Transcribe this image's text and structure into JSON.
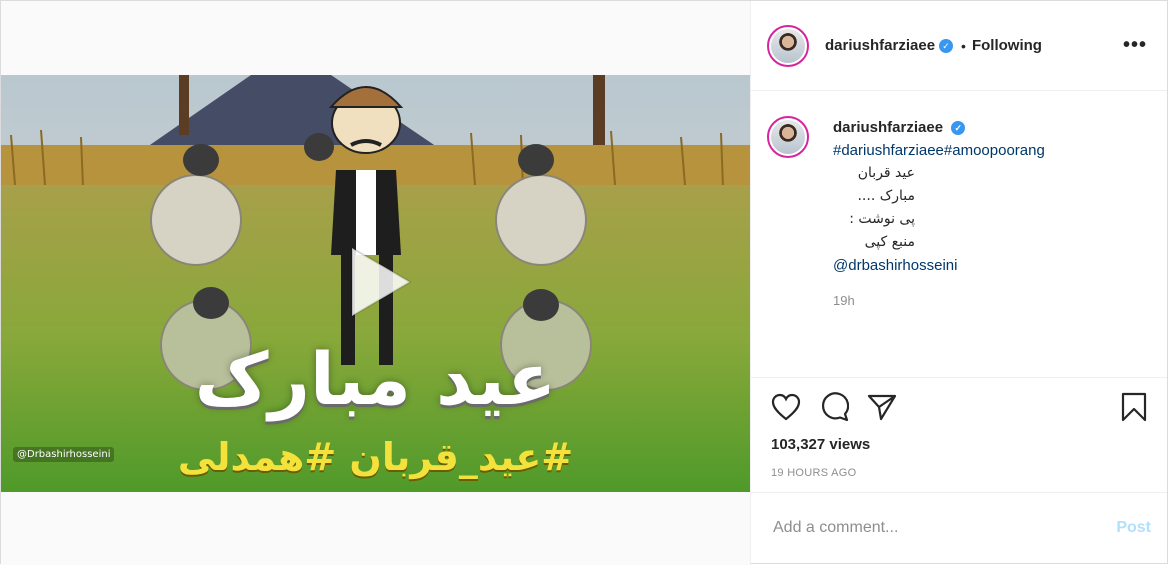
{
  "post": {
    "username": "dariushfarziaee",
    "following_label": "Following",
    "more_icon": "more-horizontal-icon"
  },
  "media": {
    "watermark": "@Drbashirhosseini",
    "overlay_title": "عید مبارک",
    "overlay_tags": "#عید_قربان #همدلی"
  },
  "caption": {
    "username": "dariushfarziaee",
    "hashtags": "#dariushfarziaee#amoopoorang",
    "line1": "عید قربان مبارک ....",
    "line2": "پی نوشت :",
    "line3": "منبع کپی",
    "mention": "@drbashirhosseini",
    "time": "19h"
  },
  "stats": {
    "views": "103,327 views",
    "posted": "19 HOURS AGO"
  },
  "comment": {
    "placeholder": "Add a comment...",
    "post_label": "Post"
  },
  "colors": {
    "link": "#00376b",
    "verified": "#3897f0",
    "post_button": "#b2dffc"
  }
}
